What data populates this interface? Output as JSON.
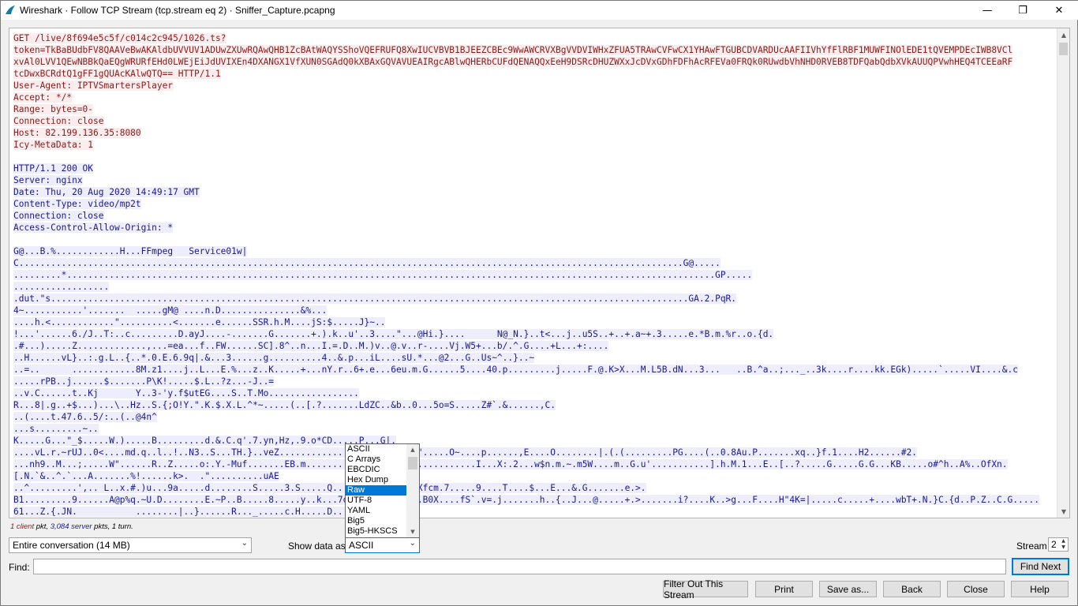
{
  "window": {
    "title": "Wireshark · Follow TCP Stream (tcp.stream eq 2) · Sniffer_Capture.pcapng",
    "minimize_glyph": "—",
    "maximize_glyph": "❐",
    "close_glyph": "✕",
    "app_icon": "wireshark-fin-icon"
  },
  "stream": {
    "lines": [
      {
        "side": "cli",
        "text": "GET /live/8f694e5c5f/c014c2c945/1026.ts?"
      },
      {
        "side": "cli",
        "text": "token=TkBaBUdbFV8QAAVeBwAKAldbUVVUV1ADUwZXUwRQAwQHB1ZcBAtWAQYSShoVQEFRUFQ8XwIUCVBVB1BJEEZCBEc9WwAWCRVXBgVVDVIWHxZFUA5TRAwCVFwCX1YHAwFTGUBCDVARDUcAAFIIVhYfFlRBF1MUWFINOlEDE1tQVEMPDEcIWB8VCl"
      },
      {
        "side": "cli",
        "text": "xvAl0LVV1QEwNBBkQaEQgWRURfEHd0LWEjEiJdUVIXEn4DXANGX1VfXUN0SGAdQ0kXBAxGQVAVUEAIRgcABlwQHERbCUFdQENAQQxEeH9DSRcDHUZWXxJcDVxGDhFDFhAcRFEVa0FRQk0RUwdbVhNHD0RVEB8TDFQabQdbXVkAUUQPVwhHEQ4TCEEaRF"
      },
      {
        "side": "cli",
        "text": "tcDwxBCRdtQ1gFF1gQUAcKAlwQTQ== HTTP/1.1"
      },
      {
        "side": "cli",
        "text": "User-Agent: IPTVSmartersPlayer"
      },
      {
        "side": "cli",
        "text": "Accept: */*"
      },
      {
        "side": "cli",
        "text": "Range: bytes=0-"
      },
      {
        "side": "cli",
        "text": "Connection: close"
      },
      {
        "side": "cli",
        "text": "Host: 82.199.136.35:8080"
      },
      {
        "side": "cli",
        "text": "Icy-MetaData: 1"
      },
      {
        "side": "none",
        "text": ""
      },
      {
        "side": "srv",
        "text": "HTTP/1.1 200 OK"
      },
      {
        "side": "srv",
        "text": "Server: nginx"
      },
      {
        "side": "srv",
        "text": "Date: Thu, 20 Aug 2020 14:49:17 GMT"
      },
      {
        "side": "srv",
        "text": "Content-Type: video/mp2t"
      },
      {
        "side": "srv",
        "text": "Connection: close"
      },
      {
        "side": "srv",
        "text": "Access-Control-Allow-Origin: *"
      },
      {
        "side": "none",
        "text": ""
      },
      {
        "side": "srv",
        "text": "G@...B.%............H...FFmpeg   Service01w|"
      },
      {
        "side": "srv",
        "text": "C.............................................................................................................................G@....."
      },
      {
        "side": "srv",
        "text": ".........*..........................................................................................................................GP....."
      },
      {
        "side": "srv",
        "text": ".................."
      },
      {
        "side": "srv",
        "text": ".dut.\"s........................................................................................................................GA.2.PqR."
      },
      {
        "side": "srv",
        "text": "4~...........'.......  .....gM@ ....n.D...............&%..."
      },
      {
        "side": "srv",
        "text": "....h.<............\"..........<.......e......SSR.h.M....jS:$.....J}~.."
      },
      {
        "side": "srv",
        "text": "!...'......6./J..T:..c.........D.ayJ....-.......G.......+.).k..u'..3....\"...@Hi.}....      N@_N.}..t<...j..u5S..+..+.a~+.3.....e.*B.m.%r..o.{d."
      },
      {
        "side": "srv",
        "text": ".#...).....Z.............,...=ea...f..FW......SC].8^..n...I.=.D..M.)v..@.v..r-....Vj.W5+...b/.^.G....+L...+:...."
      },
      {
        "side": "srv",
        "text": "..H......vL}..:.g.L..{..*.0.E.6.9q|.&...3......g..........4..&.p...iL....sU.*...@2...G..Us~^..}..~"
      },
      {
        "side": "srv",
        "text": "..=..      ............8M.z1....j..L...E.%...z..K.....+...nY.r..6+.e...6eu.m.G......5....40.p.........j.....F.@.K>X...M.L5B.dN...3...   ..B.^a..;..._..3k....r....kk.EGk).....`.....VI....&.c"
      },
      {
        "side": "srv",
        "text": ".....rPB..j......$.......P\\K!.....$.L..?z...-J..="
      },
      {
        "side": "srv",
        "text": "..v.C......t..Kj       Y..3-'y.f$utEG....S..T.Mo................."
      },
      {
        "side": "srv",
        "text": "R...8|.g..+$...)...\\..Hz..S.{;O!Y.\".K.$.X.L.^*~.....(..[.?.......LdZC..&b..0...5o=S.....Z#`.&......,C."
      },
      {
        "side": "srv",
        "text": "..(....t.47.6..5/:..(..@4n^"
      },
      {
        "side": "srv",
        "text": "...s.........~.."
      },
      {
        "side": "srv",
        "text": "K.....G...\"_$.....W.).....B.........d.&.C.q'.7.yn,Hz,.9.o*CD.....P...G|."
      },
      {
        "side": "srv",
        "text": "....vL.r.~rUJ..0<....md.q..l..!..N3..S...TH.}..veZ..........................\".....O~....p......,E....O........|.(.(.........PG....(..0.8Au.P.......xq..}f.1....H2......#2."
      },
      {
        "side": "srv",
        "text": "...nh9..M...;.....W\"......R..Z.....o:.Y.-Muf.......EB.m................................I...X:.2...w$n.m.~.m5W....m..G.u'...........].h.M.1...E..[..?.....G.....G.G...KB.....o#^h..A%..OfXn."
      },
      {
        "side": "srv",
        "text": "[.N.`&..^.`...A.......%!......k>.  .\"..........uAE"
      },
      {
        "side": "srv",
        "text": "..^.........',.. L..x.#.)u...9a.....d........S.....3.S.....Q...............aXfcm.7.....9....T....$...E...&.G.......e.>."
      },
      {
        "side": "srv",
        "text": "B1.........9......A@p%q.~U.D........E.~P..B.....8.....y..k...7o..............B0X....fS`.v=.j.......h..{..J...@.....+.>.......i?....K..>g...F....H\"4K=|.....c.....+....wbT+.N.}C.{d..P.Z..C.G....."
      },
      {
        "side": "srv",
        "text": "61...Z.{.JN.           ........|..}......R..._.....c.H.....D..."
      }
    ]
  },
  "summary": {
    "client_part": "1 client",
    "mid": " pkt, ",
    "server_part": "3,084 server",
    "tail": " pkts, 1 turn."
  },
  "controls": {
    "conversation_value": "Entire conversation (14 MB)",
    "show_data_label": "Show data as",
    "show_data_value": "ASCII",
    "stream_label": "Stream",
    "stream_value": "2",
    "find_label": "Find:",
    "find_value": "",
    "find_next": "Find Next"
  },
  "encoding_options": [
    {
      "label": "ASCII",
      "selected": false
    },
    {
      "label": "C Arrays",
      "selected": false
    },
    {
      "label": "EBCDIC",
      "selected": false
    },
    {
      "label": "Hex Dump",
      "selected": false
    },
    {
      "label": "Raw",
      "selected": true
    },
    {
      "label": "UTF-8",
      "selected": false
    },
    {
      "label": "YAML",
      "selected": false
    },
    {
      "label": "Big5",
      "selected": false
    },
    {
      "label": "Big5-HKSCS",
      "selected": false
    }
  ],
  "buttons": {
    "filter_out": "Filter Out This Stream",
    "print": "Print",
    "save_as": "Save as...",
    "back": "Back",
    "close": "Close",
    "help": "Help"
  },
  "colors": {
    "client_text": "#8b1a1a",
    "client_bg": "#fbeded",
    "server_text": "#1a1a8b",
    "server_bg": "#ededfb",
    "selection": "#0078d7"
  }
}
